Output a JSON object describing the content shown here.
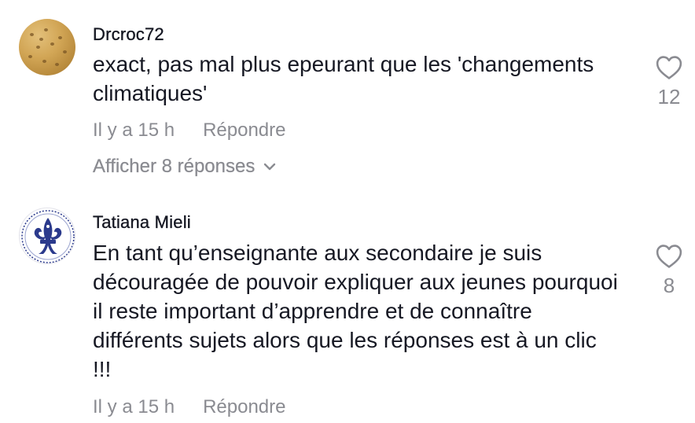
{
  "comments": [
    {
      "username": "Drcroc72",
      "text": "exact, pas mal plus epeurant que les 'changements climatiques'",
      "time": "Il y a 15 h",
      "reply_label": "Répondre",
      "likes": "12",
      "avatar_icon": "cracker-avatar",
      "view_replies_label": "Afficher 8 réponses"
    },
    {
      "username": "Tatiana Mieli",
      "text": "En tant qu’enseignante aux secondaire je suis découragée de pouvoir expliquer aux jeunes pourquoi il reste important d’apprendre et de connaître différents sujets alors que les réponses est à un clic !!!",
      "time": "Il y a 15 h",
      "reply_label": "Répondre",
      "likes": "8",
      "avatar_icon": "fleur-de-lis-avatar"
    }
  ],
  "colors": {
    "text_primary": "#161823",
    "text_secondary": "#8a8b91",
    "fleur_blue": "#2b3a8c"
  }
}
